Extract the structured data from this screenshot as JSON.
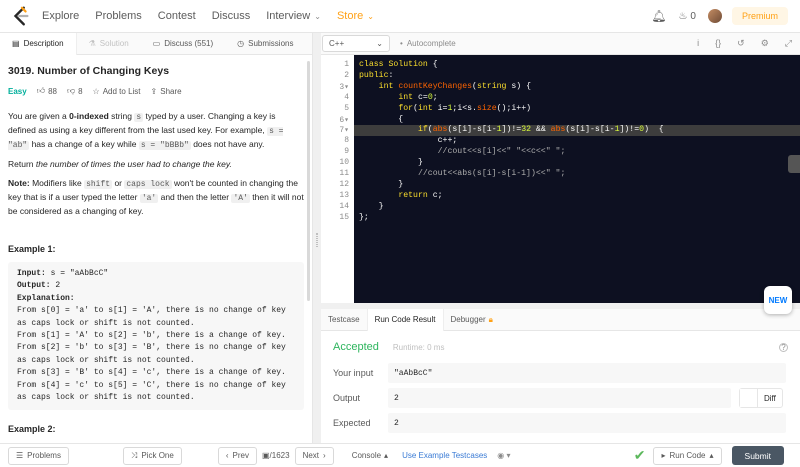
{
  "nav": {
    "items": [
      "Explore",
      "Problems",
      "Contest",
      "Discuss",
      "Interview",
      "Store"
    ],
    "streak_count": "0",
    "premium_label": "Premium"
  },
  "left_tabs": {
    "description": "Description",
    "solution": "Solution",
    "discuss": "Discuss (551)",
    "submissions": "Submissions"
  },
  "problem": {
    "title": "3019. Number of Changing Keys",
    "difficulty": "Easy",
    "likes": "88",
    "dislikes": "8",
    "add_to_list": "Add to List",
    "share": "Share",
    "p1_a": "You are given a ",
    "p1_bold": "0-indexed",
    "p1_b": " string ",
    "p1_code1": "s",
    "p1_c": " typed by a user. Changing a key is defined as using a key different from the last used key. For example, ",
    "p1_code2": "s = \"ab\"",
    "p1_d": " has a change of a key while ",
    "p1_code3": "s = \"bBBb\"",
    "p1_e": " does not have any.",
    "p2_a": "Return ",
    "p2_em": "the number of times the user had to change the key.",
    "p3_bold": "Note:",
    "p3_a": " Modifiers like ",
    "p3_code1": "shift",
    "p3_b": " or ",
    "p3_code2": "caps lock",
    "p3_c": " won't be counted in changing the key that is if a user typed the letter ",
    "p3_code3": "'a'",
    "p3_d": " and then the letter ",
    "p3_code4": "'A'",
    "p3_e": " then it will not be considered as a changing of key.",
    "example1_title": "Example 1:",
    "example1_input_label": "Input:",
    "example1_input": " s = \"aAbBcC\"",
    "example1_output_label": "Output:",
    "example1_output": " 2",
    "example1_expl_label": "Explanation:",
    "example1_expl": "From s[0] = 'a' to s[1] = 'A', there is no change of key\nas caps lock or shift is not counted.\nFrom s[1] = 'A' to s[2] = 'b', there is a change of key.\nFrom s[2] = 'b' to s[3] = 'B', there is no change of key\nas caps lock or shift is not counted.\nFrom s[3] = 'B' to s[4] = 'c', there is a change of key.\nFrom s[4] = 'c' to s[5] = 'C', there is no change of key\nas caps lock or shift is not counted.",
    "example2_title": "Example 2:"
  },
  "editor": {
    "language": "C++",
    "autocomplete": "Autocomplete",
    "line_numbers": [
      "1",
      "2",
      "3",
      "4",
      "5",
      "6",
      "7",
      "8",
      "9",
      "10",
      "11",
      "12",
      "13",
      "14",
      "15"
    ],
    "new_badge": "NEW"
  },
  "result": {
    "tabs": [
      "Testcase",
      "Run Code Result",
      "Debugger"
    ],
    "status": "Accepted",
    "runtime": "Runtime: 0 ms",
    "your_input_label": "Your input",
    "your_input": "\"aAbBcC\"",
    "output_label": "Output",
    "output": "2",
    "expected_label": "Expected",
    "expected": "2",
    "diff_label": "Diff"
  },
  "bottom": {
    "problems": "Problems",
    "pick_one": "Pick One",
    "prev": "Prev",
    "page": "/1623",
    "next": "Next",
    "console": "Console",
    "use_example": "Use Example Testcases",
    "run_code": "Run Code",
    "submit": "Submit"
  },
  "colors": {
    "accent": "#ffa116",
    "accepted": "#2db55d",
    "easy": "#00af9b",
    "editor_bg": "#0d1021"
  }
}
